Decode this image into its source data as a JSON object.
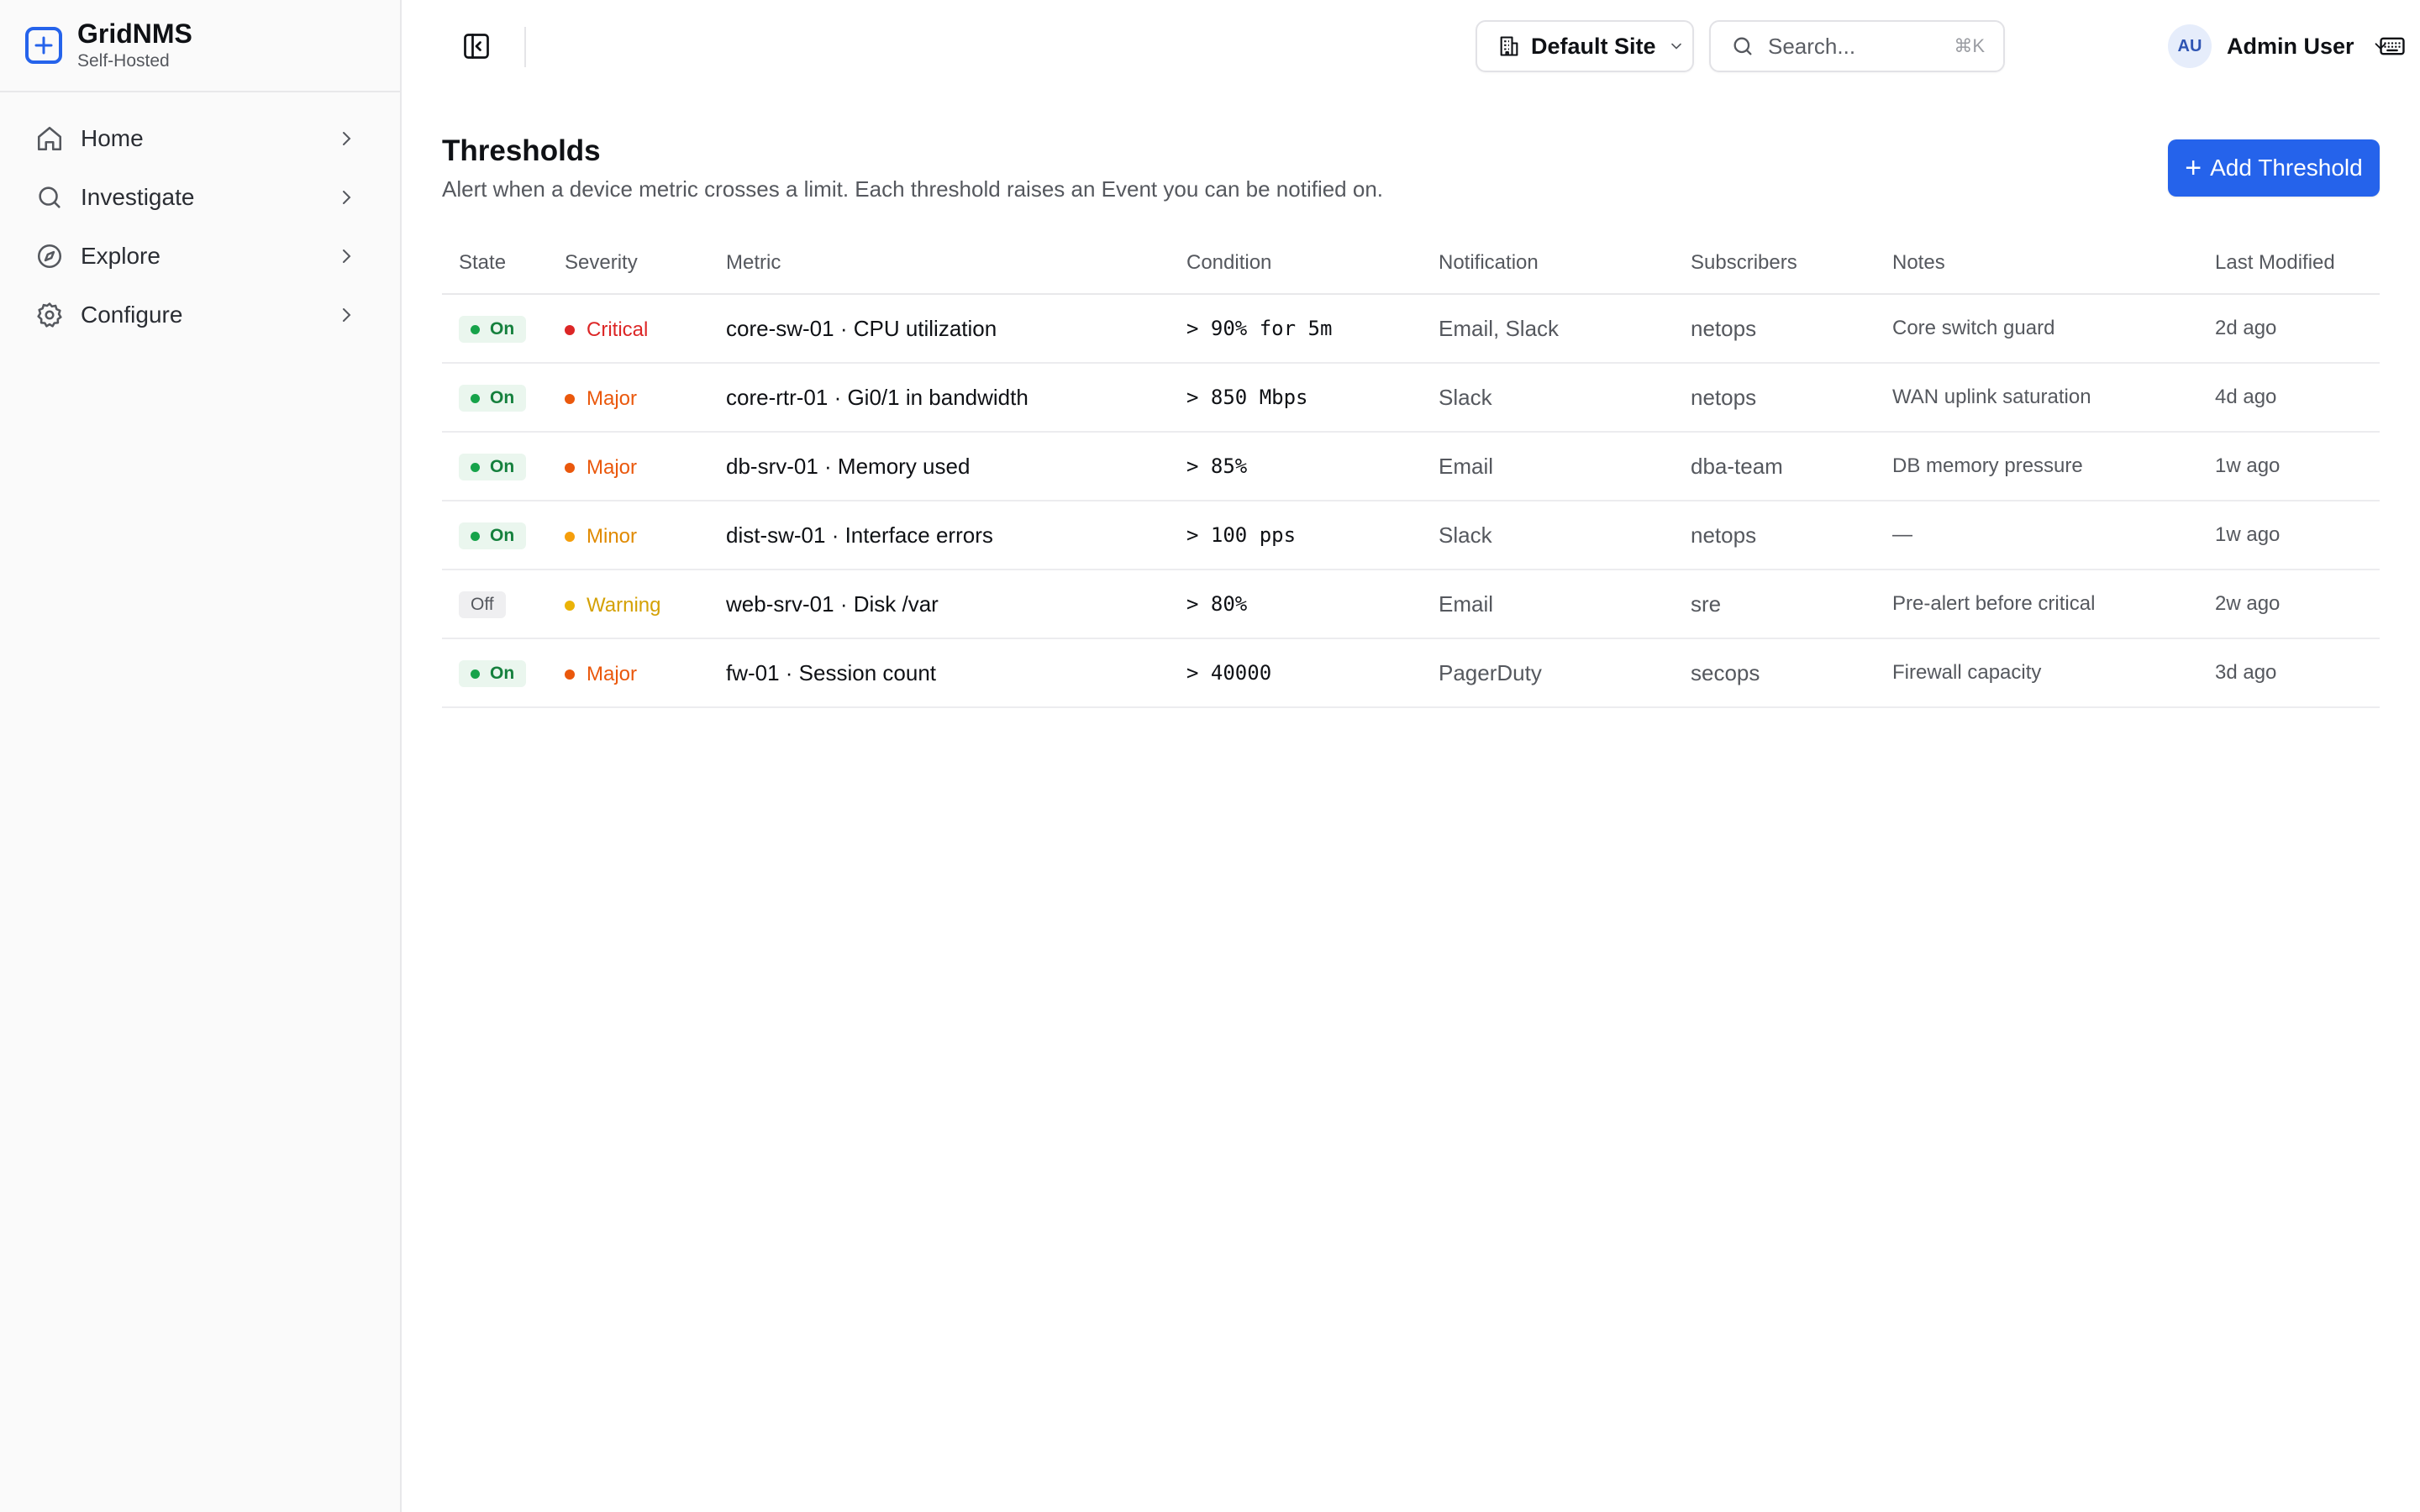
{
  "brand": {
    "name": "GridNMS",
    "subtitle": "Self-Hosted"
  },
  "nav": [
    {
      "label": "Home",
      "icon": "home-icon"
    },
    {
      "label": "Investigate",
      "icon": "search-icon"
    },
    {
      "label": "Explore",
      "icon": "compass-icon"
    },
    {
      "label": "Configure",
      "icon": "gear-icon"
    }
  ],
  "topbar": {
    "site": "Default Site",
    "search_placeholder": "Search...",
    "search_shortcut": "⌘K",
    "user_initials": "AU",
    "user_name": "Admin User"
  },
  "page": {
    "title": "Thresholds",
    "description": "Alert when a device metric crosses a limit. Each threshold raises an Event you can be notified on.",
    "add_button": "Add Threshold"
  },
  "table": {
    "columns": [
      "State",
      "Severity",
      "Metric",
      "Condition",
      "Notification",
      "Subscribers",
      "Notes",
      "Last Modified"
    ],
    "rows": [
      {
        "state": "On",
        "severity": "Critical",
        "metric": "core-sw-01 · CPU utilization",
        "condition": "> 90% for 5m",
        "notification": "Email, Slack",
        "subscribers": "netops",
        "notes": "Core switch guard",
        "modified": "2d ago"
      },
      {
        "state": "On",
        "severity": "Major",
        "metric": "core-rtr-01 · Gi0/1 in bandwidth",
        "condition": "> 850 Mbps",
        "notification": "Slack",
        "subscribers": "netops",
        "notes": "WAN uplink saturation",
        "modified": "4d ago"
      },
      {
        "state": "On",
        "severity": "Major",
        "metric": "db-srv-01 · Memory used",
        "condition": "> 85%",
        "notification": "Email",
        "subscribers": "dba-team",
        "notes": "DB memory pressure",
        "modified": "1w ago"
      },
      {
        "state": "On",
        "severity": "Minor",
        "metric": "dist-sw-01 · Interface errors",
        "condition": "> 100 pps",
        "notification": "Slack",
        "subscribers": "netops",
        "notes": "—",
        "modified": "1w ago"
      },
      {
        "state": "Off",
        "severity": "Warning",
        "metric": "web-srv-01 · Disk /var",
        "condition": "> 80%",
        "notification": "Email",
        "subscribers": "sre",
        "notes": "Pre-alert before critical",
        "modified": "2w ago"
      },
      {
        "state": "On",
        "severity": "Major",
        "metric": "fw-01 · Session count",
        "condition": "> 40000",
        "notification": "PagerDuty",
        "subscribers": "secops",
        "notes": "Firewall capacity",
        "modified": "3d ago"
      }
    ]
  },
  "colors": {
    "accent": "#2563eb",
    "severity": {
      "Critical": "#dc2626",
      "Major": "#ea580c",
      "Minor": "#f59e0b",
      "Warning": "#eab308"
    },
    "severity_text": {
      "Critical": "#dc2626",
      "Major": "#ea580c",
      "Minor": "#e08a00",
      "Warning": "#d4a106"
    },
    "state_on": "#16a34a"
  }
}
